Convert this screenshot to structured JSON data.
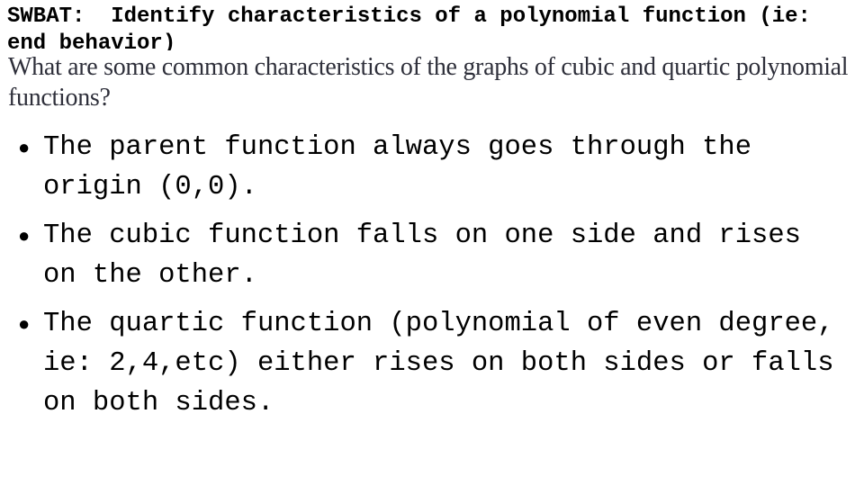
{
  "slide": {
    "objective": "SWBAT:  Identify characteristics of a polynomial function (ie: end behavior)",
    "question": "What are some common characteristics of the graphs of cubic and quartic polynomial functions?",
    "bullet_icon": "bullet-dot",
    "bullets": [
      "The parent function always goes through the origin (0,0).",
      "The cubic function falls on one side and rises on the other.",
      "The quartic function (polynomial of even degree, ie: 2,4,etc) either rises on both sides or falls on both sides."
    ]
  }
}
